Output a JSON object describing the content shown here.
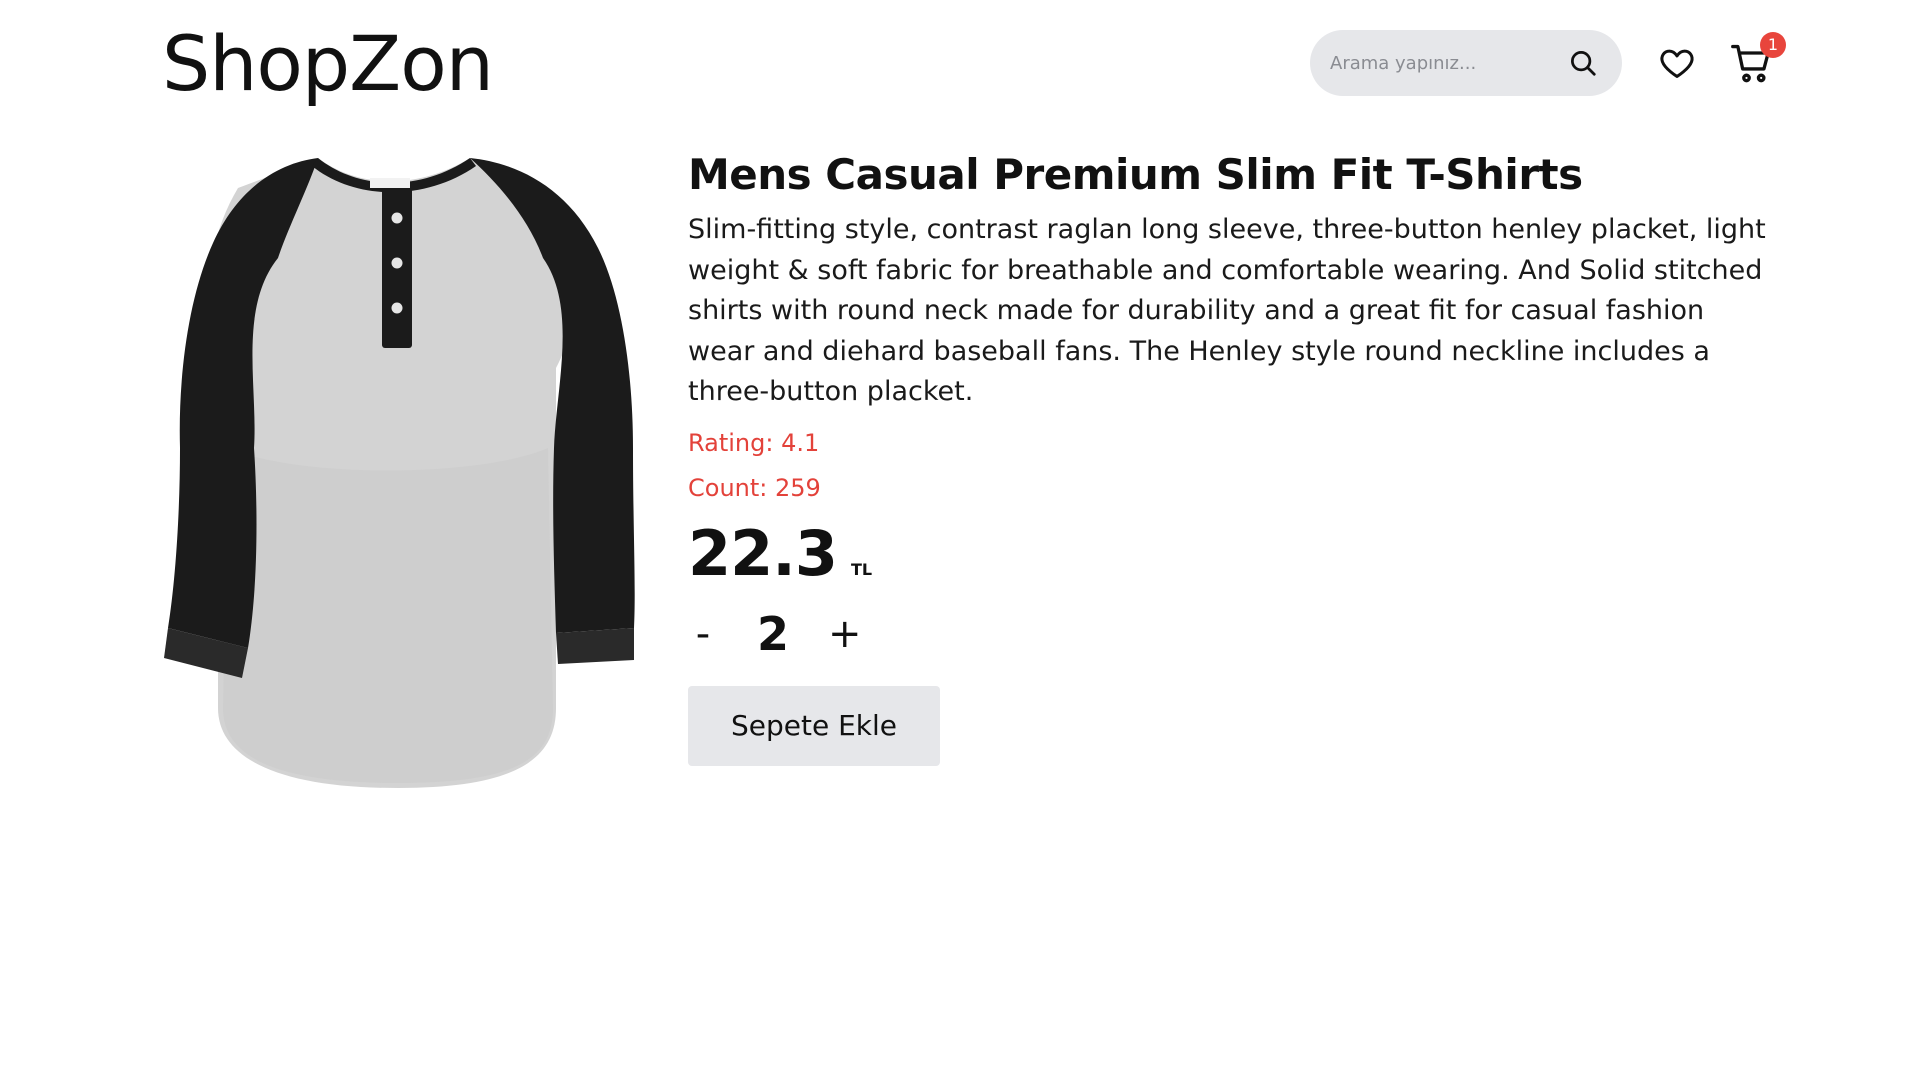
{
  "header": {
    "logo": "ShopZon",
    "search": {
      "placeholder": "Arama yapınız...",
      "value": ""
    },
    "icons": {
      "search": "search-icon",
      "favorites": "heart-icon",
      "cart": "cart-icon"
    },
    "cart_count": "1"
  },
  "product": {
    "image_icon": "t-shirt-product-image",
    "title": "Mens Casual Premium Slim Fit T-Shirts",
    "description": "Slim-fitting style, contrast raglan long sleeve, three-button henley placket, light weight & soft fabric for breathable and comfortable wearing. And Solid stitched shirts with round neck made for durability and a great fit for casual fashion wear and diehard baseball fans. The Henley style round neckline includes a three-button placket.",
    "rating_text": "Rating: 4.1",
    "count_text": "Count: 259",
    "price": "22.3",
    "currency": "TL",
    "quantity": {
      "decrement_label": "-",
      "value": "2",
      "increment_label": "+"
    },
    "add_to_cart_label": "Sepete Ekle"
  },
  "colors": {
    "accent_red": "#e3423a",
    "badge_red": "#e8453c",
    "search_bg": "#e6e7ea",
    "button_bg": "#e6e7ea"
  }
}
